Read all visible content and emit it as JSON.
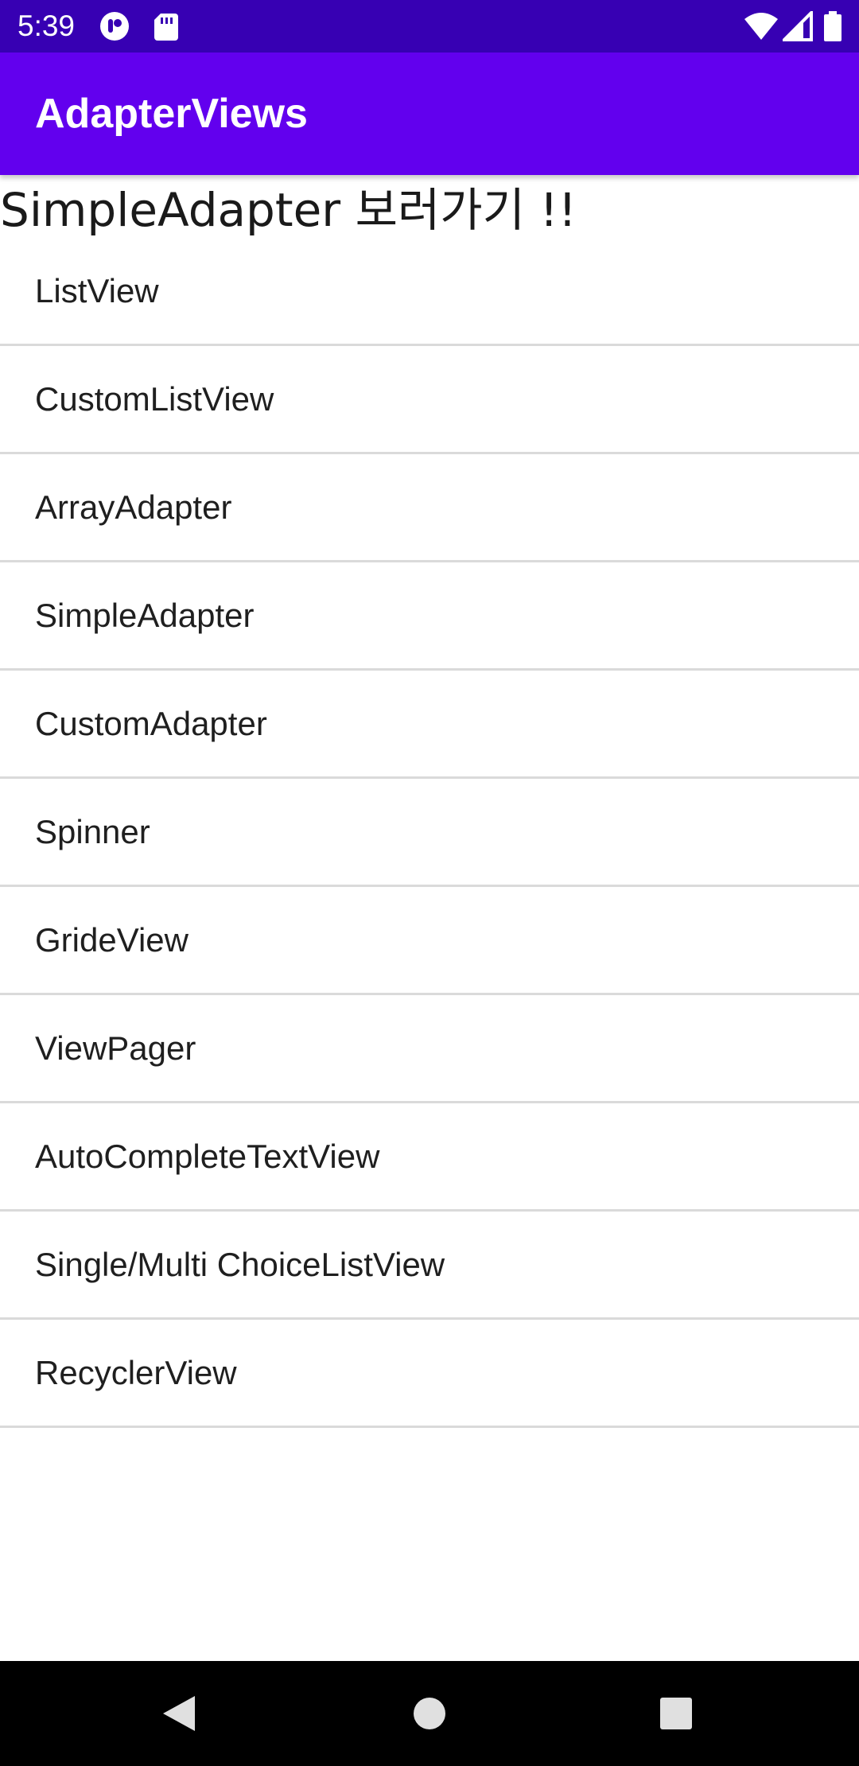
{
  "status_bar": {
    "time": "5:39",
    "icons": [
      "notification-app-icon",
      "sd-card-icon",
      "wifi-icon",
      "cell-signal-icon",
      "battery-icon"
    ],
    "background": "#3700b3"
  },
  "app_bar": {
    "title": "AdapterViews",
    "background": "#6200ee"
  },
  "heading": "SimpleAdapter 보러가기 !!",
  "list": {
    "items": [
      {
        "label": "ListView"
      },
      {
        "label": "CustomListView"
      },
      {
        "label": "ArrayAdapter"
      },
      {
        "label": "SimpleAdapter"
      },
      {
        "label": "CustomAdapter"
      },
      {
        "label": "Spinner"
      },
      {
        "label": "GrideView"
      },
      {
        "label": "ViewPager"
      },
      {
        "label": "AutoCompleteTextView"
      },
      {
        "label": "Single/Multi ChoiceListView"
      },
      {
        "label": "RecyclerView"
      }
    ]
  },
  "nav_bar": {
    "buttons": [
      "back-icon",
      "home-icon",
      "recents-icon"
    ]
  }
}
